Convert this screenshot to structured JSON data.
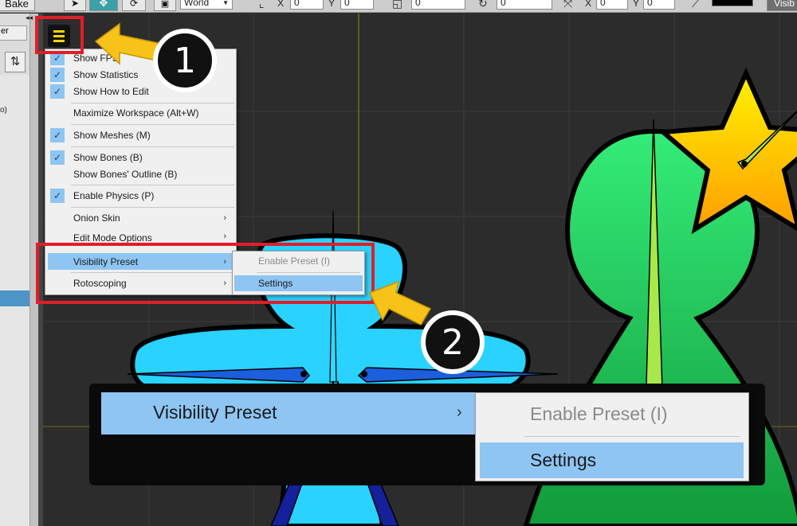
{
  "toolbar": {
    "bake_label": "Bake",
    "space_value": "World",
    "pos_x_label": "X",
    "pos_x_value": "0",
    "pos_y_label": "Y",
    "pos_y_value": "0",
    "rot_value": "0",
    "rot2_value": "0",
    "scale_x_label": "X",
    "scale_x_value": "0",
    "scale_y_label": "Y",
    "scale_y_value": "0",
    "visibility_label": "Visib",
    "left_fragment": "er",
    "collapse_glyph": "◂◂"
  },
  "menu": {
    "items": [
      {
        "label": "Show FPS",
        "checked": true
      },
      {
        "label": "Show Statistics",
        "checked": true
      },
      {
        "label": "Show How to Edit",
        "checked": true
      },
      {
        "label": "Maximize Workspace (Alt+W)",
        "checked": false
      },
      {
        "label": "Show Meshes (M)",
        "checked": true
      },
      {
        "label": "Show Bones (B)",
        "checked": true
      },
      {
        "label": "Show Bones' Outline (B)",
        "checked": false
      },
      {
        "label": "Enable Physics (P)",
        "checked": true
      },
      {
        "label": "Onion Skin",
        "checked": false
      },
      {
        "label": "Edit Mode Options",
        "checked": false
      },
      {
        "label": "Visibility Preset",
        "checked": false
      },
      {
        "label": "Rotoscoping",
        "checked": false
      }
    ],
    "submenu": {
      "enable_preset": "Enable Preset (I)",
      "settings": "Settings"
    }
  },
  "zoom": {
    "label": "Visibility Preset",
    "enable_preset": "Enable Preset (I)",
    "settings": "Settings"
  },
  "badges": {
    "one": "1",
    "two": "2"
  },
  "colors": {
    "accent_highlight": "#8ec5f3",
    "annotation_red": "#e01e2a",
    "arrow_yellow": "#f7c31a",
    "hamburger_yellow": "#ffd400",
    "character_blue": "#29d2ff",
    "character_green": "#21dc6b",
    "star_yellow": "#ffd000"
  },
  "icons": {
    "hamburger": "menu-icon",
    "sort": "sort-arrows-icon",
    "submenu_arrow": "chevron-right-icon"
  }
}
